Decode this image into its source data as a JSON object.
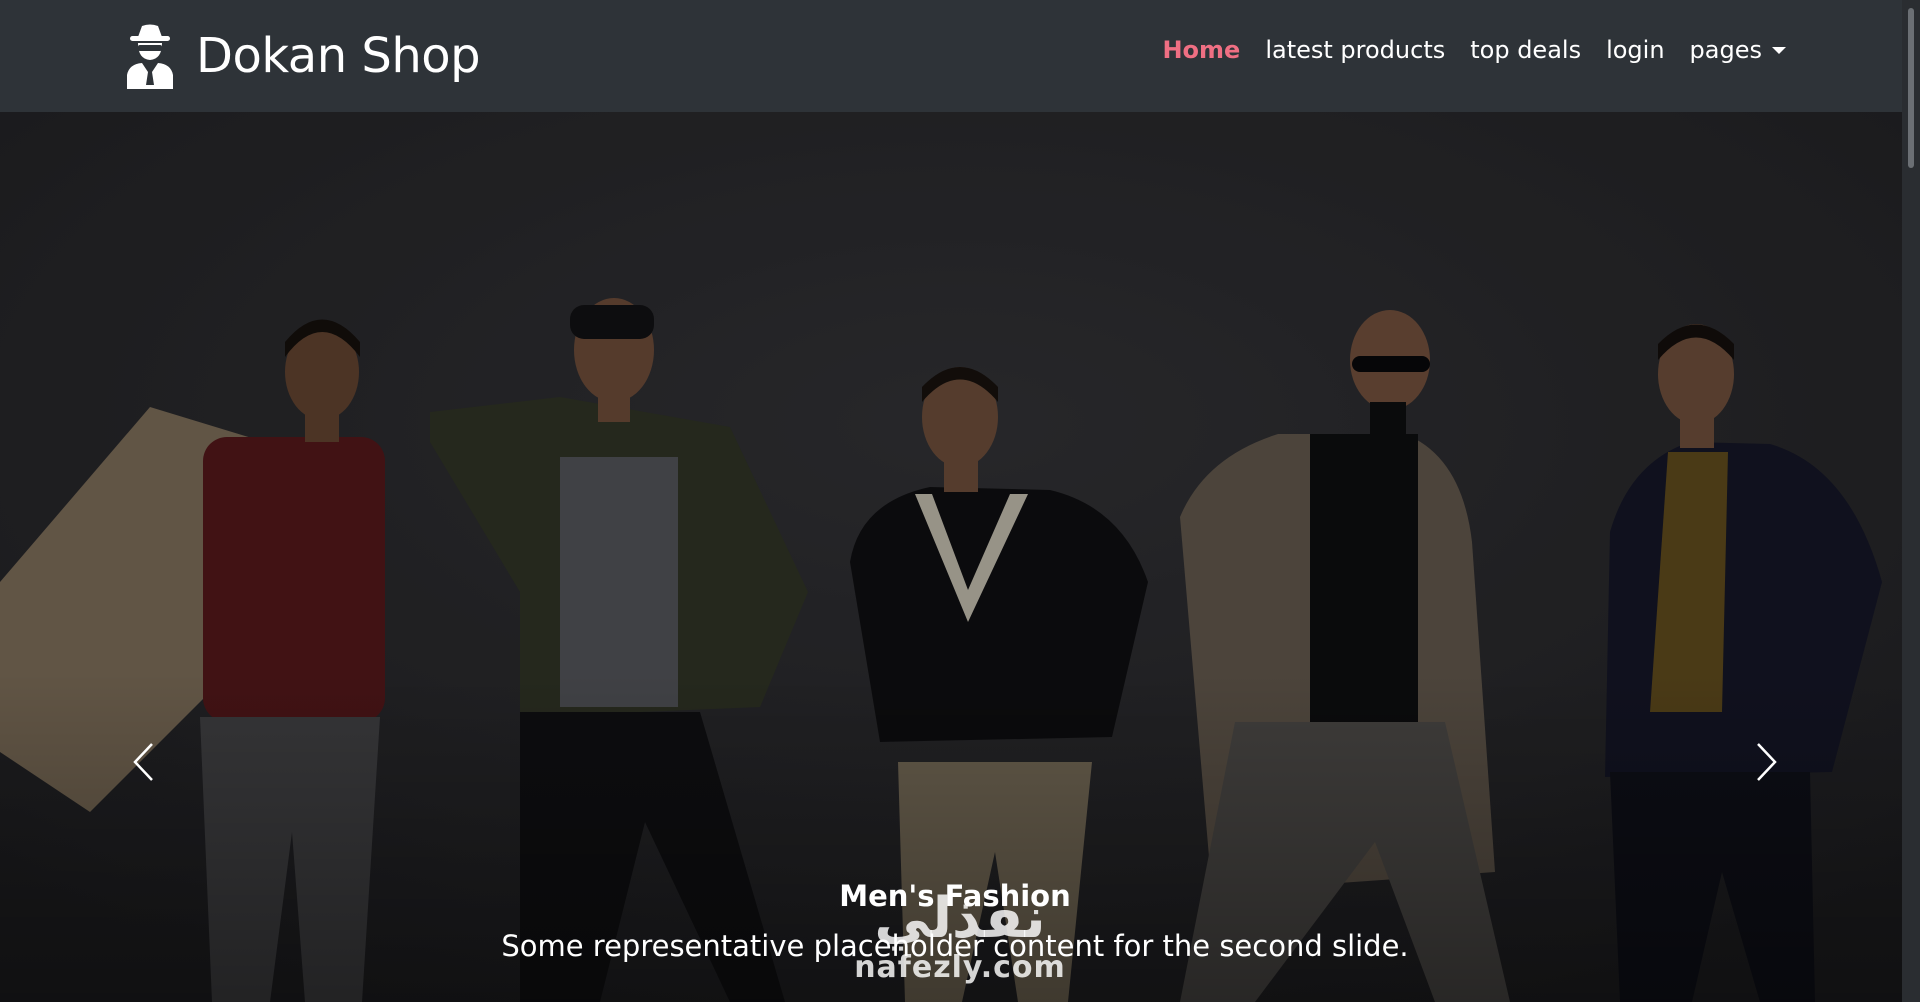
{
  "brand": {
    "name": "Dokan Shop",
    "icon": "user-secret-icon"
  },
  "nav": {
    "items": [
      {
        "label": "Home",
        "active": true
      },
      {
        "label": "latest products",
        "active": false
      },
      {
        "label": "top deals",
        "active": false
      },
      {
        "label": "login",
        "active": false
      },
      {
        "label": "pages",
        "active": false,
        "dropdown": true
      }
    ]
  },
  "carousel": {
    "caption_title": "Men's Fashion",
    "caption_text": "Some representative placeholder content for the second slide.",
    "prev_icon": "chevron-left-icon",
    "next_icon": "chevron-right-icon"
  },
  "watermark": {
    "arabic": "نفذلي",
    "latin": "nafezly.com"
  },
  "colors": {
    "navbar_bg": "#2e3338",
    "active_link": "#ef6f83",
    "slide_bg": "#2f2f33"
  }
}
